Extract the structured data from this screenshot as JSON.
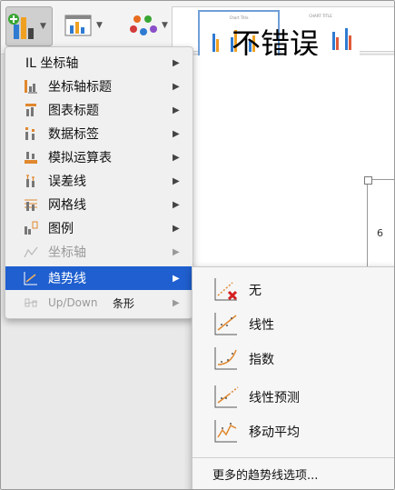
{
  "toolbar": {
    "buttons": [
      {
        "name": "add-chart-element-button",
        "icon": "add-chart-element-icon",
        "active": true
      },
      {
        "name": "quick-layout-button",
        "icon": "quick-layout-icon",
        "active": false
      },
      {
        "name": "change-colors-button",
        "icon": "change-colors-icon",
        "active": false
      }
    ],
    "gallery_thumb_titles": [
      "Chart Title",
      "CHART TITLE"
    ]
  },
  "overlay_text": "不错误",
  "canvas": {
    "visible_number": "6"
  },
  "menu": {
    "items": [
      {
        "label": "IL 坐标轴",
        "icon": "",
        "has_submenu": true,
        "state": "normal"
      },
      {
        "label": "坐标轴标题",
        "icon": "axis-titles-icon",
        "has_submenu": true,
        "state": "normal"
      },
      {
        "label": "图表标题",
        "icon": "chart-title-icon",
        "has_submenu": true,
        "state": "normal"
      },
      {
        "label": "数据标签",
        "icon": "data-labels-icon",
        "has_submenu": true,
        "state": "normal"
      },
      {
        "label": "模拟运算表",
        "icon": "data-table-icon",
        "has_submenu": true,
        "state": "normal"
      },
      {
        "label": "误差线",
        "icon": "error-bars-icon",
        "has_submenu": true,
        "state": "normal"
      },
      {
        "label": "网格线",
        "icon": "gridlines-icon",
        "has_submenu": true,
        "state": "normal"
      },
      {
        "label": "图例",
        "icon": "legend-icon",
        "has_submenu": true,
        "state": "normal"
      },
      {
        "label": "坐标轴",
        "icon": "lines-icon",
        "has_submenu": true,
        "state": "disabled"
      },
      {
        "label": "趋势线",
        "icon": "trendline-icon",
        "has_submenu": true,
        "state": "highlighted"
      },
      {
        "label": "Up/Down",
        "icon": "up-down-bars-icon",
        "has_submenu": true,
        "state": "disabled"
      }
    ],
    "updown_extra": "条形",
    "arrow_glyph": "▶"
  },
  "submenu": {
    "items": [
      {
        "label": "无",
        "icon": "trendline-none-icon"
      },
      {
        "label": "线性",
        "icon": "trendline-linear-icon"
      },
      {
        "label": "指数",
        "icon": "trendline-exponential-icon"
      },
      {
        "label": "线性预测",
        "icon": "trendline-linear-forecast-icon"
      },
      {
        "label": "移动平均",
        "icon": "trendline-moving-average-icon"
      }
    ],
    "more_options": "更多的趋势线选项..."
  },
  "colors": {
    "highlight": "#1f5fcf",
    "trend": "#e0882e",
    "remove_x": "#d42020"
  }
}
